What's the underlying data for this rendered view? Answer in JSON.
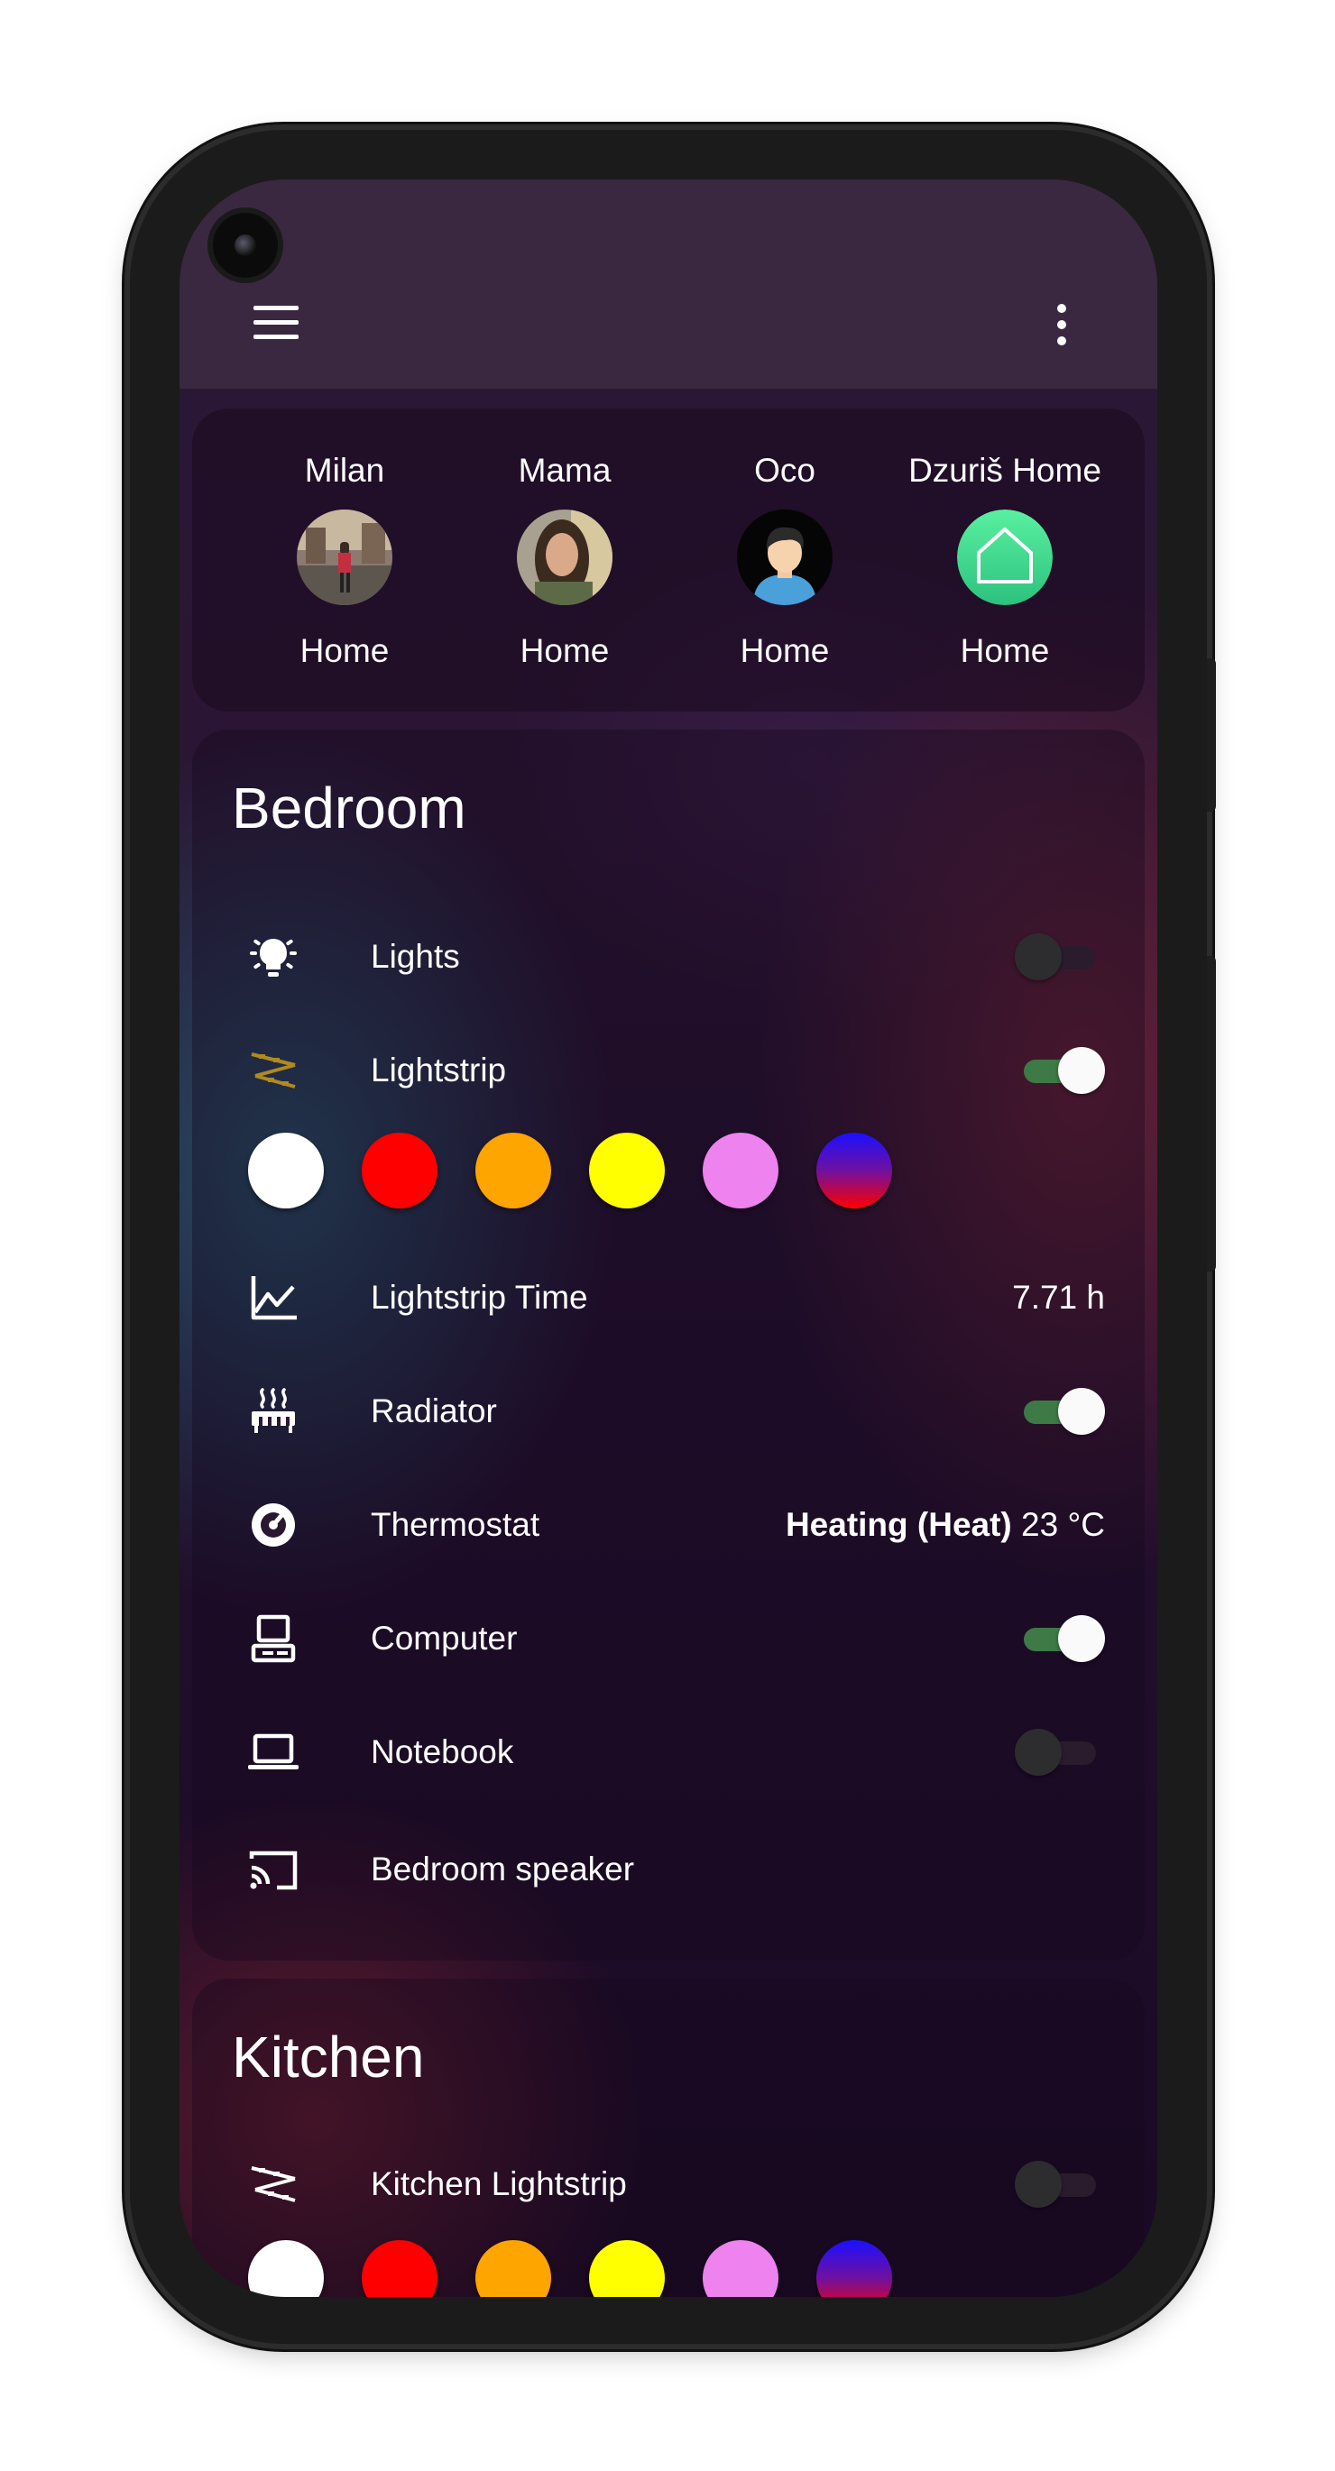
{
  "appbar": {
    "menu_icon": "menu-icon",
    "overflow_icon": "more-vertical-icon"
  },
  "persons": [
    {
      "name": "Milan",
      "state": "Home",
      "avatar": "photo-avatar-milan"
    },
    {
      "name": "Mama",
      "state": "Home",
      "avatar": "photo-avatar-mama"
    },
    {
      "name": "Oco",
      "state": "Home",
      "avatar": "person-avatar-icon"
    },
    {
      "name": "Dzuriš Home",
      "state": "Home",
      "avatar": "home-icon"
    }
  ],
  "bedroom": {
    "title": "Bedroom",
    "rows": [
      {
        "label": "Lights",
        "icon": "ceiling-light-icon",
        "toggle": false
      },
      {
        "label": "Lightstrip",
        "icon": "led-strip-icon",
        "toggle": true
      },
      {
        "label": "Lightstrip Time",
        "icon": "chart-line-icon",
        "value": "7.71 h"
      },
      {
        "label": "Radiator",
        "icon": "radiator-icon",
        "toggle": true
      },
      {
        "label": "Thermostat",
        "icon": "thermostat-icon",
        "value_bold": "Heating (Heat)",
        "value": "23 °C"
      },
      {
        "label": "Computer",
        "icon": "desktop-icon",
        "toggle": true
      },
      {
        "label": "Notebook",
        "icon": "laptop-icon",
        "toggle": false
      },
      {
        "label": "Bedroom speaker",
        "icon": "cast-icon"
      }
    ],
    "swatch_colors": [
      "#ffffff",
      "#ff0000",
      "#ffa500",
      "#ffff00",
      "#ee82ee",
      "blue-red-gradient"
    ]
  },
  "kitchen": {
    "title": "Kitchen",
    "rows": [
      {
        "label": "Kitchen Lightstrip",
        "icon": "led-strip-icon",
        "toggle": false
      }
    ],
    "swatch_colors": [
      "#ffffff",
      "#ff0000",
      "#ffa500",
      "#ffff00",
      "#ee82ee",
      "blue-red-gradient"
    ]
  },
  "colors": {
    "toggle_on": "#3d7a45",
    "appbar": "#3a2840",
    "home_badge": "#3ee08f"
  }
}
